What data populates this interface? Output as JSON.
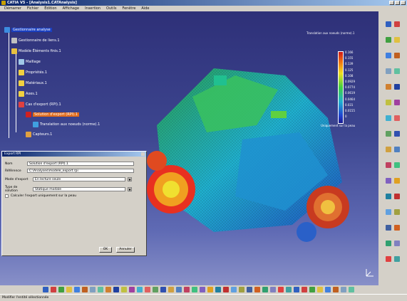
{
  "window": {
    "title": "CATIA V5 - [Analysis1.CATAnalysis]"
  },
  "menu": [
    "Démarrer",
    "Fichier",
    "Édition",
    "Affichage",
    "Insertion",
    "Outils",
    "Fenêtre",
    "Aide"
  ],
  "tree": {
    "root": "Gestionnaire analyse",
    "nodes": [
      "Gestionnaire de liens.1",
      "Modèle Éléments finis.1",
      "Maillage",
      "Propriétés.1",
      "Matériaux.1",
      "Axes.1",
      "Cas d'export (RPI).1",
      "Solution d'export (RPI).1",
      "Translation aux noeuds (norme).1",
      "Capteurs.1"
    ]
  },
  "legend": {
    "title": "Translation aux noeuds (norme).1",
    "values": [
      "0.166",
      "0.155",
      "0.139",
      "0.125",
      "0.108",
      "0.0929",
      "0.0774",
      "0.0619",
      "0.0464",
      "0.031",
      "0.0155",
      "0"
    ],
    "footer": "Uniquement sur la peau",
    "colors": [
      "#d01818",
      "#e83a12",
      "#f07a10",
      "#f0b010",
      "#f0e020",
      "#90e030",
      "#40d040",
      "#20c090",
      "#20b0d0",
      "#2070d8",
      "#2040d0",
      "#1a1a90"
    ]
  },
  "dialog": {
    "title": "Export RPI",
    "fields": [
      {
        "label": "Nom",
        "value": "Solution d'export (RPI).1"
      },
      {
        "label": "Référence",
        "value": "C:\\Analyses\\modele_export.rpi"
      },
      {
        "label": "Mode d'export",
        "value": "En lecture seule"
      },
      {
        "label": "Type de solution",
        "value": "Statique modale"
      }
    ],
    "checkbox_label": "Calculer l'export uniquement sur la peau",
    "ok_label": "OK",
    "cancel_label": "Annuler"
  },
  "status": "Modifier l'entité sélectionnée"
}
